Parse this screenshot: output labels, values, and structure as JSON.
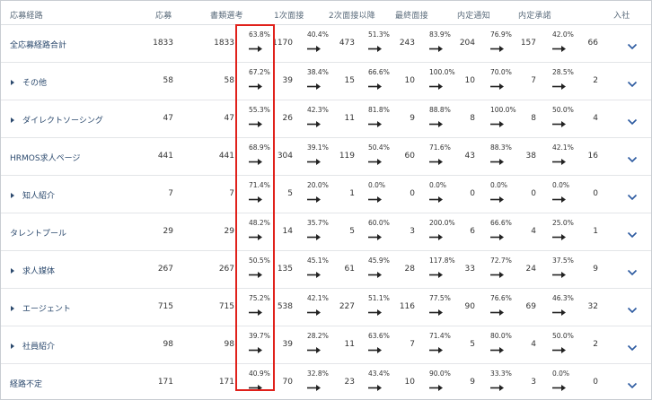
{
  "headers": [
    "応募経路",
    "応募",
    "書類選考",
    "1次面接",
    "2次面接以降",
    "最終面接",
    "内定通知",
    "内定承諾",
    "入社"
  ],
  "rows": [
    {
      "label": "全応募経路合計",
      "expandable": false,
      "applied": "1833",
      "doc": "1833",
      "r1": "63.8%",
      "i1": "1170",
      "r2": "40.4%",
      "i2": "473",
      "r3": "51.3%",
      "fin": "243",
      "r4": "83.9%",
      "offer": "204",
      "r5": "76.9%",
      "acc": "157",
      "r6": "42.0%",
      "join": "66"
    },
    {
      "label": "その他",
      "expandable": true,
      "applied": "58",
      "doc": "58",
      "r1": "67.2%",
      "i1": "39",
      "r2": "38.4%",
      "i2": "15",
      "r3": "66.6%",
      "fin": "10",
      "r4": "100.0%",
      "offer": "10",
      "r5": "70.0%",
      "acc": "7",
      "r6": "28.5%",
      "join": "2"
    },
    {
      "label": "ダイレクトソーシング",
      "expandable": true,
      "applied": "47",
      "doc": "47",
      "r1": "55.3%",
      "i1": "26",
      "r2": "42.3%",
      "i2": "11",
      "r3": "81.8%",
      "fin": "9",
      "r4": "88.8%",
      "offer": "8",
      "r5": "100.0%",
      "acc": "8",
      "r6": "50.0%",
      "join": "4"
    },
    {
      "label": "HRMOS求人ページ",
      "expandable": false,
      "applied": "441",
      "doc": "441",
      "r1": "68.9%",
      "i1": "304",
      "r2": "39.1%",
      "i2": "119",
      "r3": "50.4%",
      "fin": "60",
      "r4": "71.6%",
      "offer": "43",
      "r5": "88.3%",
      "acc": "38",
      "r6": "42.1%",
      "join": "16"
    },
    {
      "label": "知人紹介",
      "expandable": true,
      "applied": "7",
      "doc": "7",
      "r1": "71.4%",
      "i1": "5",
      "r2": "20.0%",
      "i2": "1",
      "r3": "0.0%",
      "fin": "0",
      "r4": "0.0%",
      "offer": "0",
      "r5": "0.0%",
      "acc": "0",
      "r6": "0.0%",
      "join": "0"
    },
    {
      "label": "タレントプール",
      "expandable": false,
      "applied": "29",
      "doc": "29",
      "r1": "48.2%",
      "i1": "14",
      "r2": "35.7%",
      "i2": "5",
      "r3": "60.0%",
      "fin": "3",
      "r4": "200.0%",
      "offer": "6",
      "r5": "66.6%",
      "acc": "4",
      "r6": "25.0%",
      "join": "1"
    },
    {
      "label": "求人媒体",
      "expandable": true,
      "applied": "267",
      "doc": "267",
      "r1": "50.5%",
      "i1": "135",
      "r2": "45.1%",
      "i2": "61",
      "r3": "45.9%",
      "fin": "28",
      "r4": "117.8%",
      "offer": "33",
      "r5": "72.7%",
      "acc": "24",
      "r6": "37.5%",
      "join": "9"
    },
    {
      "label": "エージェント",
      "expandable": true,
      "applied": "715",
      "doc": "715",
      "r1": "75.2%",
      "i1": "538",
      "r2": "42.1%",
      "i2": "227",
      "r3": "51.1%",
      "fin": "116",
      "r4": "77.5%",
      "offer": "90",
      "r5": "76.6%",
      "acc": "69",
      "r6": "46.3%",
      "join": "32"
    },
    {
      "label": "社員紹介",
      "expandable": true,
      "applied": "98",
      "doc": "98",
      "r1": "39.7%",
      "i1": "39",
      "r2": "28.2%",
      "i2": "11",
      "r3": "63.6%",
      "fin": "7",
      "r4": "71.4%",
      "offer": "5",
      "r5": "80.0%",
      "acc": "4",
      "r6": "50.0%",
      "join": "2"
    },
    {
      "label": "経路不定",
      "expandable": false,
      "applied": "171",
      "doc": "171",
      "r1": "40.9%",
      "i1": "70",
      "r2": "32.8%",
      "i2": "23",
      "r3": "43.4%",
      "fin": "10",
      "r4": "90.0%",
      "offer": "9",
      "r5": "33.3%",
      "acc": "3",
      "r6": "0.0%",
      "join": "0"
    }
  ],
  "colors": {
    "link": "#2c4a6e",
    "highlight": "#e0211b",
    "border": "#e3e5e8",
    "header_text": "#5a6b7b"
  },
  "icons": {
    "arrow": "right-arrow-icon",
    "chevron": "chevron-down-icon",
    "expand": "caret-right-icon"
  }
}
